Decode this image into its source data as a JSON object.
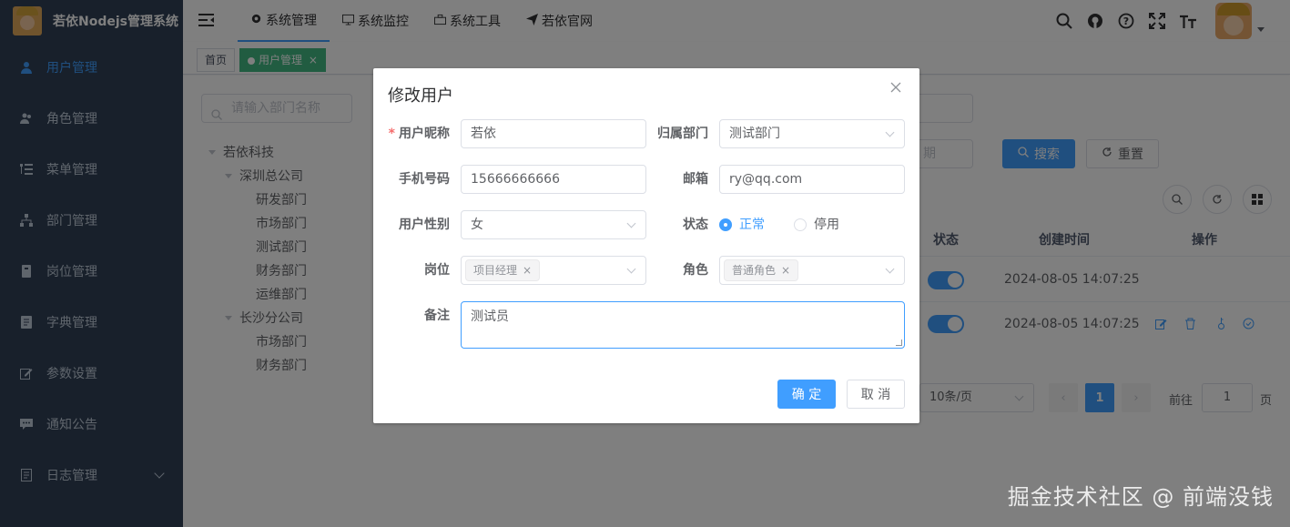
{
  "app": {
    "title": "若依Nodejs管理系统"
  },
  "sidebar": {
    "items": [
      {
        "label": "用户管理",
        "icon": "user-icon",
        "active": true
      },
      {
        "label": "角色管理",
        "icon": "peoples-icon"
      },
      {
        "label": "菜单管理",
        "icon": "tree-table-icon"
      },
      {
        "label": "部门管理",
        "icon": "tree-icon"
      },
      {
        "label": "岗位管理",
        "icon": "post-icon"
      },
      {
        "label": "字典管理",
        "icon": "dict-icon"
      },
      {
        "label": "参数设置",
        "icon": "edit-icon"
      },
      {
        "label": "通知公告",
        "icon": "message-icon"
      },
      {
        "label": "日志管理",
        "icon": "log-icon",
        "has_children": true
      }
    ]
  },
  "topnav": {
    "items": [
      {
        "label": "系统管理",
        "icon": "gear-icon",
        "active": true
      },
      {
        "label": "系统监控",
        "icon": "monitor-icon"
      },
      {
        "label": "系统工具",
        "icon": "toolbox-icon"
      },
      {
        "label": "若依官网",
        "icon": "paper-plane-icon"
      }
    ],
    "right_icons": [
      "search-icon",
      "github-icon",
      "question-icon",
      "fullscreen-icon",
      "font-size-icon"
    ]
  },
  "tags": [
    {
      "label": "首页"
    },
    {
      "label": "用户管理",
      "active": true
    }
  ],
  "background": {
    "dept_search_placeholder": "请输入部门名称",
    "tree": [
      {
        "label": "若依科技",
        "level": 0,
        "expanded": true
      },
      {
        "label": "深圳总公司",
        "level": 1,
        "expanded": true
      },
      {
        "label": "研发部门",
        "level": 2
      },
      {
        "label": "市场部门",
        "level": 2
      },
      {
        "label": "测试部门",
        "level": 2
      },
      {
        "label": "财务部门",
        "level": 2
      },
      {
        "label": "运维部门",
        "level": 2
      },
      {
        "label": "长沙分公司",
        "level": 1,
        "expanded": true
      },
      {
        "label": "市场部门",
        "level": 2
      },
      {
        "label": "财务部门",
        "level": 2
      }
    ],
    "date_placeholder_tail": "期",
    "search_button": "搜索",
    "reset_button": "重置",
    "table": {
      "headers": {
        "status": "状态",
        "created": "创建时间",
        "actions": "操作"
      },
      "rows": [
        {
          "status_on": true,
          "created": "2024-08-05 14:07:25"
        },
        {
          "status_on": true,
          "created": "2024-08-05 14:07:25"
        }
      ]
    },
    "pagination": {
      "page_size": "10条/页",
      "current_page": "1",
      "goto_label": "前往",
      "goto_value": "1",
      "page_suffix": "页"
    }
  },
  "dialog": {
    "title": "修改用户",
    "fields": {
      "nickname": {
        "label": "用户昵称",
        "value": "若依",
        "required": true
      },
      "dept": {
        "label": "归属部门",
        "value": "测试部门"
      },
      "phone": {
        "label": "手机号码",
        "value": "15666666666"
      },
      "email": {
        "label": "邮箱",
        "value": "ry@qq.com"
      },
      "sex": {
        "label": "用户性别",
        "value": "女"
      },
      "status": {
        "label": "状态",
        "options": [
          "正常",
          "停用"
        ],
        "selected": "正常"
      },
      "post": {
        "label": "岗位",
        "tags": [
          "项目经理"
        ]
      },
      "role": {
        "label": "角色",
        "tags": [
          "普通角色"
        ]
      },
      "remark": {
        "label": "备注",
        "value": "测试员"
      }
    },
    "confirm_button": "确 定",
    "cancel_button": "取 消"
  },
  "watermark": "掘金技术社区 @ 前端没钱",
  "colors": {
    "primary": "#409eff",
    "sidebar_bg": "#304156",
    "sidebar_text": "#bfcbd9",
    "tag_active": "#42b983"
  }
}
